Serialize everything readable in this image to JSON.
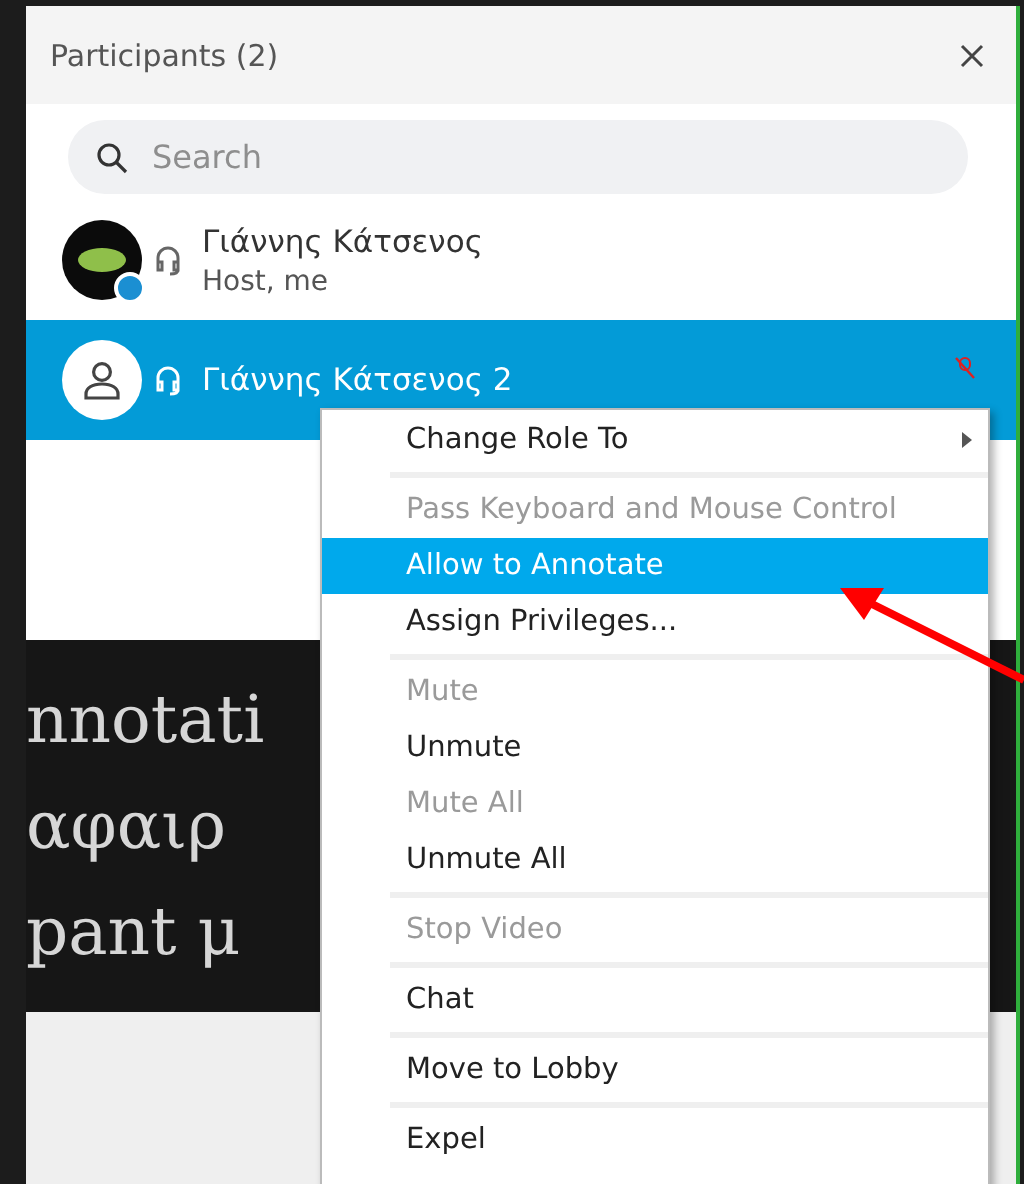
{
  "panel": {
    "title": "Participants (2)",
    "search": {
      "placeholder": "Search"
    },
    "participants": [
      {
        "name": "Γιάννης Κάτσενος",
        "role": "Host, me",
        "kind": "host",
        "selected": false,
        "muted": false
      },
      {
        "name": "Γιάννης Κάτσενος 2",
        "kind": "guest",
        "selected": true,
        "muted": true
      }
    ]
  },
  "slide": {
    "lines": [
      "nnotati",
      "αφαιρ",
      "pant μ"
    ]
  },
  "context_menu": {
    "groups": [
      [
        {
          "label": "Change Role To",
          "kind": "submenu",
          "disabled": false,
          "selected": false
        }
      ],
      [
        {
          "label": "Pass Keyboard and Mouse Control",
          "kind": "item",
          "disabled": true,
          "selected": false
        },
        {
          "label": "Allow to Annotate",
          "kind": "item",
          "disabled": false,
          "selected": true
        },
        {
          "label": "Assign Privileges...",
          "kind": "item",
          "disabled": false,
          "selected": false
        }
      ],
      [
        {
          "label": "Mute",
          "kind": "item",
          "disabled": true,
          "selected": false
        },
        {
          "label": "Unmute",
          "kind": "item",
          "disabled": false,
          "selected": false
        },
        {
          "label": "Mute All",
          "kind": "item",
          "disabled": true,
          "selected": false
        },
        {
          "label": "Unmute All",
          "kind": "item",
          "disabled": false,
          "selected": false
        }
      ],
      [
        {
          "label": "Stop Video",
          "kind": "item",
          "disabled": true,
          "selected": false
        }
      ],
      [
        {
          "label": "Chat",
          "kind": "item",
          "disabled": false,
          "selected": false
        }
      ],
      [
        {
          "label": "Move to Lobby",
          "kind": "item",
          "disabled": false,
          "selected": false
        }
      ],
      [
        {
          "label": "Expel",
          "kind": "item",
          "disabled": false,
          "selected": false
        }
      ]
    ]
  }
}
